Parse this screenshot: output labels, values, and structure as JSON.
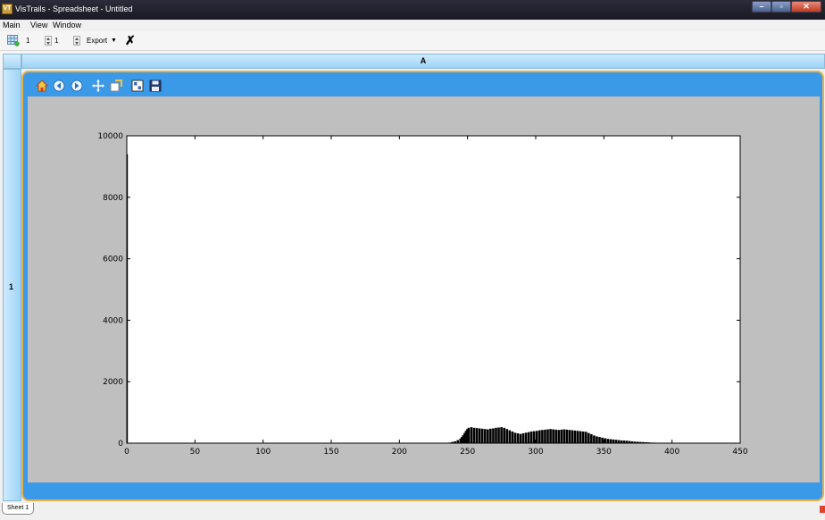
{
  "window": {
    "title": "VisTrails - Spreadsheet - Untitled",
    "app_icon_text": "VT"
  },
  "menu": {
    "items": [
      "Main",
      "View",
      "Window"
    ]
  },
  "toolbar": {
    "rows_value": "1",
    "cols_value": "1",
    "export_label": "Export"
  },
  "spreadsheet": {
    "column_header": "A",
    "row_header": "1",
    "sheet_tab": "Sheet 1"
  },
  "colors": {
    "cell_border": "#e8b04a",
    "cell_bg": "#3a9ae8",
    "header_bg": "#9dd3f5",
    "figure_bg": "#bfbfbf"
  },
  "plot_toolbar_icons": [
    "home-icon",
    "back-icon",
    "forward-icon",
    "pan-icon",
    "zoom-icon",
    "configure-subplots-icon",
    "save-icon"
  ],
  "chart_data": {
    "type": "bar",
    "xlim": [
      0,
      450
    ],
    "ylim": [
      0,
      10000
    ],
    "xticks": [
      0,
      50,
      100,
      150,
      200,
      250,
      300,
      350,
      400,
      450
    ],
    "yticks": [
      0,
      2000,
      4000,
      6000,
      8000,
      10000
    ],
    "grid": false,
    "x": [
      0,
      236,
      238,
      240,
      242,
      244,
      245,
      246,
      247,
      248,
      249,
      250,
      252,
      254,
      256,
      258,
      260,
      262,
      264,
      266,
      268,
      270,
      272,
      274,
      276,
      278,
      280,
      282,
      284,
      286,
      288,
      290,
      292,
      294,
      296,
      298,
      300,
      302,
      304,
      306,
      308,
      310,
      312,
      314,
      316,
      318,
      320,
      322,
      324,
      326,
      328,
      330,
      332,
      334,
      336,
      338,
      340,
      342,
      344,
      346,
      348,
      350,
      352,
      354,
      356,
      358,
      360,
      362,
      364,
      366,
      368,
      370,
      372,
      374,
      376,
      378,
      380,
      382,
      384,
      386,
      388,
      390,
      392,
      394,
      396,
      398,
      400,
      402
    ],
    "values": [
      9400,
      20,
      40,
      60,
      100,
      150,
      200,
      260,
      330,
      400,
      460,
      500,
      520,
      500,
      490,
      480,
      470,
      460,
      450,
      470,
      480,
      500,
      510,
      520,
      500,
      460,
      420,
      380,
      340,
      320,
      300,
      320,
      340,
      360,
      380,
      390,
      400,
      420,
      430,
      440,
      450,
      460,
      450,
      440,
      430,
      440,
      450,
      440,
      430,
      420,
      410,
      400,
      390,
      380,
      370,
      330,
      290,
      250,
      220,
      200,
      180,
      160,
      140,
      130,
      120,
      110,
      100,
      90,
      85,
      80,
      70,
      60,
      50,
      45,
      40,
      35,
      30,
      25,
      20,
      18,
      15,
      12,
      10,
      8,
      6,
      4,
      3,
      2
    ]
  }
}
